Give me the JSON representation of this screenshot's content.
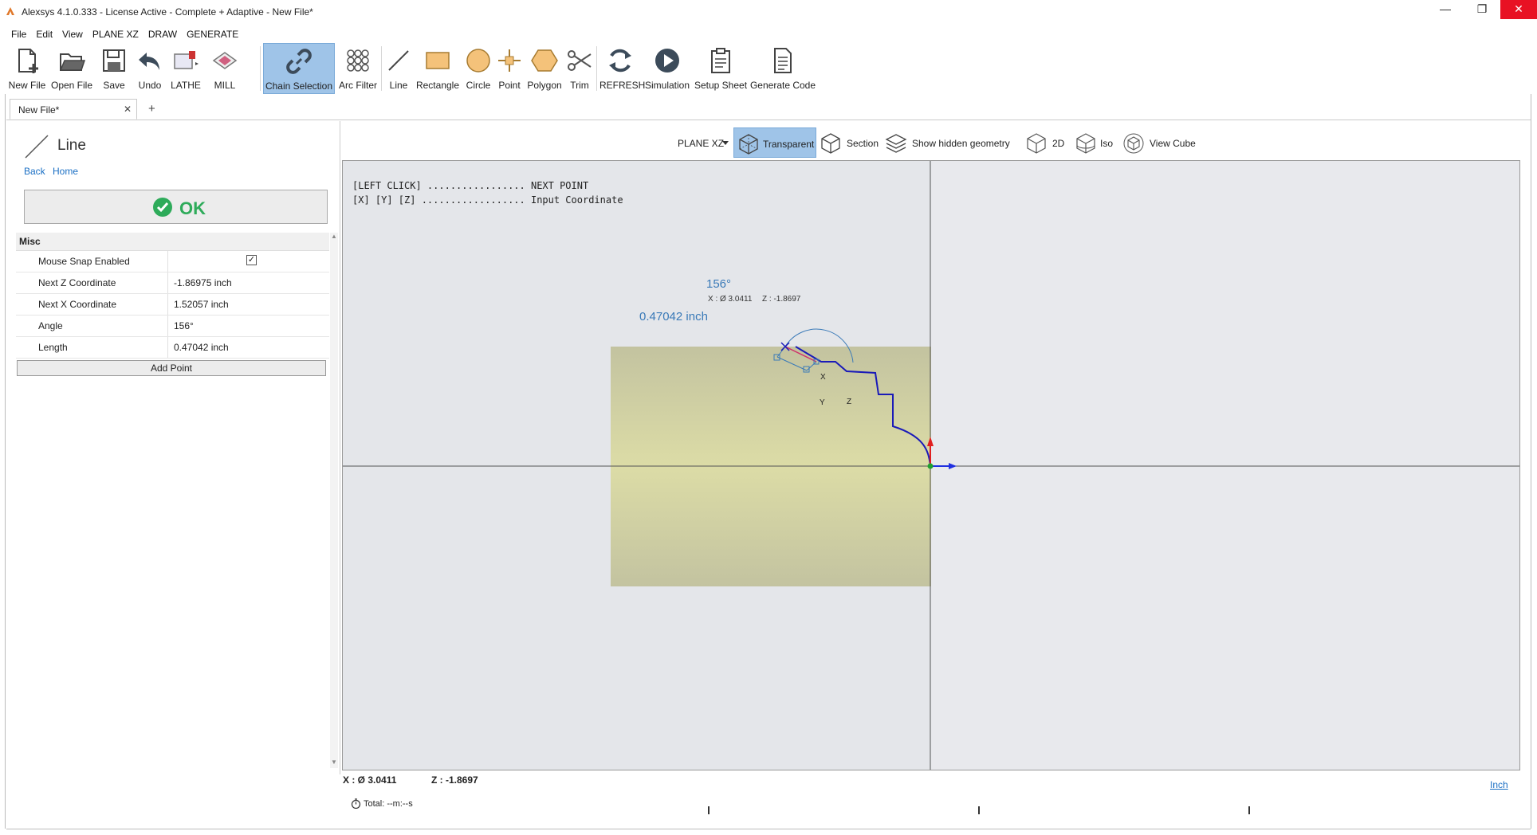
{
  "window": {
    "title": "Alexsys 4.1.0.333 - License Active -  Complete + Adaptive - New File*",
    "minimize": "—",
    "restore": "❐",
    "close": "✕"
  },
  "menu": [
    "File",
    "Edit",
    "View",
    "PLANE XZ",
    "DRAW",
    "GENERATE"
  ],
  "ribbon": {
    "new_file": "New File",
    "open_file": "Open File",
    "save": "Save",
    "undo": "Undo",
    "lathe": "LATHE",
    "mill": "MILL",
    "chain_selection": "Chain Selection",
    "arc_filter": "Arc Filter",
    "line": "Line",
    "rectangle": "Rectangle",
    "circle": "Circle",
    "point": "Point",
    "polygon": "Polygon",
    "trim": "Trim",
    "refresh": "REFRESH",
    "simulation": "Simulation",
    "setup_sheet": "Setup Sheet",
    "generate_code": "Generate Code"
  },
  "tabs": {
    "file_tab": "New File*",
    "close": "✕",
    "add": "+"
  },
  "panel": {
    "title": "Line",
    "back": "Back",
    "home": "Home",
    "ok": "OK",
    "misc_header": "Misc",
    "properties": [
      {
        "name": "Mouse Snap Enabled",
        "value": ""
      },
      {
        "name": "Next Z Coordinate",
        "value": "-1.86975 inch"
      },
      {
        "name": "Next X Coordinate",
        "value": "1.52057 inch"
      },
      {
        "name": "Angle",
        "value": "156°"
      },
      {
        "name": "Length",
        "value": "0.47042 inch"
      }
    ],
    "snap_checked": "✓",
    "add_point": "Add Point",
    "scroll_up": "▲",
    "scroll_down": "▼"
  },
  "viewport_toolbar": {
    "plane": "PLANE XZ",
    "transparent": "Transparent",
    "section": "Section",
    "show_hidden": "Show hidden geometry",
    "view_2d": "2D",
    "iso": "Iso",
    "view_cube": "View Cube"
  },
  "viewport": {
    "hint_line1": "[LEFT CLICK] ................. NEXT POINT",
    "hint_line2": "[X] [Y] [Z] .................. Input Coordinate",
    "angle_label": "156°",
    "length_label": "0.47042 inch",
    "cursor_x": "X : Ø 3.0411",
    "cursor_z": "Z : -1.8697",
    "axis_x": "X",
    "axis_y": "Y",
    "axis_z": "Z",
    "stock_color": "#d4d49c",
    "toolpath_color": "#1a1ab8",
    "dim_color": "#3a7ab8"
  },
  "status": {
    "x": "X : Ø 3.0411",
    "z": "Z : -1.8697",
    "units": "Inch",
    "total": "Total:  --m:--s"
  }
}
